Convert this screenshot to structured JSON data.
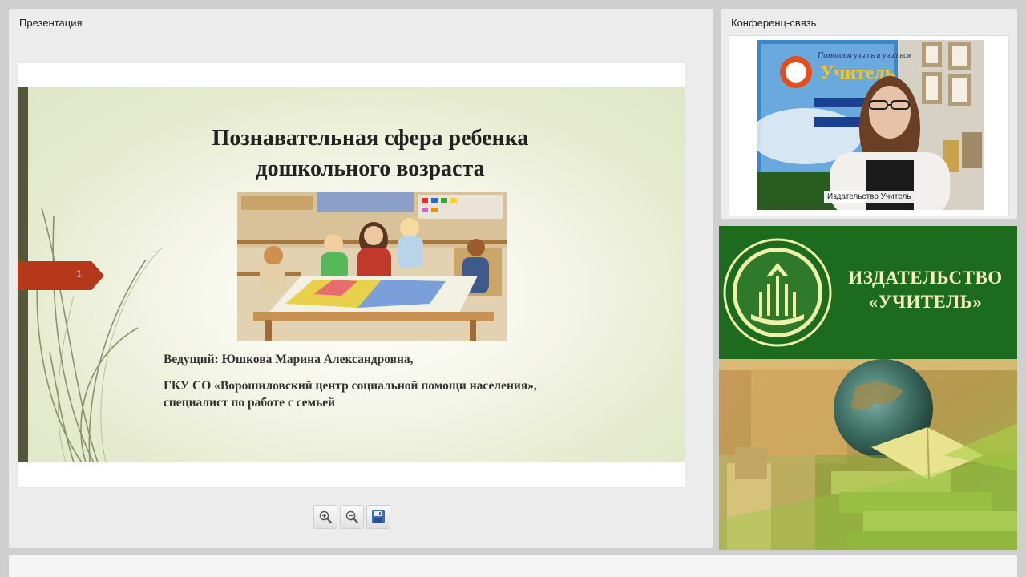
{
  "presentation": {
    "panel_title": "Презентация",
    "slide": {
      "title_line1": "Познавательная сфера ребенка",
      "title_line2": "дошкольного возраста",
      "page_number": "1",
      "host": "Ведущий: Юшкова Марина Александровна,",
      "org_line1": "ГКУ СО «Ворошиловский центр социальной помощи населения»,",
      "org_line2": "специалист по работе с семьей",
      "accent_color": "#b5381a"
    },
    "toolbar": {
      "zoom_in_icon": "zoom-in-icon",
      "zoom_out_icon": "zoom-out-icon",
      "save_icon": "save-icon"
    }
  },
  "conference": {
    "panel_title": "Конференц-связь",
    "participant_name": "Издательство Учитель"
  },
  "publisher": {
    "name_line1": "ИЗДАТЕЛЬСТВО",
    "name_line2": "«УЧИТЕЛЬ»",
    "brand_color": "#1c6b1f"
  }
}
